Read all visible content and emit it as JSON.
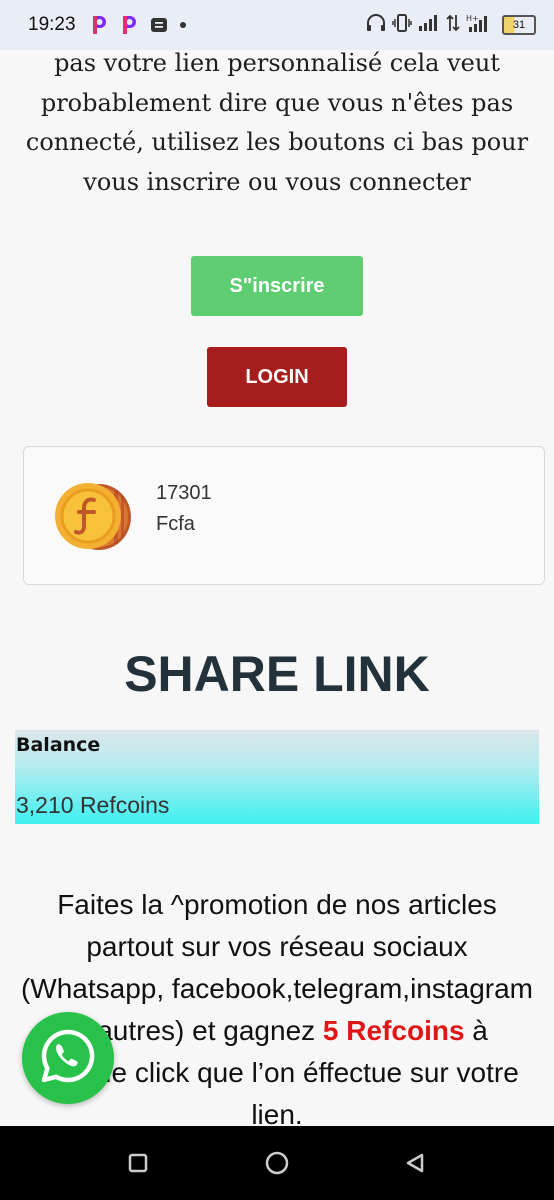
{
  "status_bar": {
    "time": "19:23",
    "battery": "31",
    "network": "H+"
  },
  "intro": {
    "lines": [
      "pas votre lien personnalisé cela veut",
      "probablement dire que vous n'êtes pas",
      "connecté, utilisez les boutons ci bas pour",
      "vous inscrire ou vous connecter"
    ]
  },
  "buttons": {
    "signup": "S\"inscrire",
    "login": "LOGIN"
  },
  "coin_card": {
    "amount": "17301",
    "unit": "Fcfa"
  },
  "share": {
    "title": "SHARE LINK"
  },
  "balance": {
    "label": "Balance",
    "value": "3,210 Refcoins"
  },
  "promo": {
    "text_before": "Faites la ^promotion de nos articles partout sur vos réseau sociaux (Whatsapp, facebook,telegram,instagram et autres) et gagnez ",
    "highlight": "5 Refcoins",
    "text_after": " à chaque click que l’on éffectue sur votre lien."
  },
  "colors": {
    "signup_bg": "#5fcd72",
    "login_bg": "#a71d1d",
    "whatsapp": "#28c24a",
    "highlight": "#e01616"
  },
  "icons": {
    "whatsapp": "whatsapp-icon",
    "coin": "coin-icon"
  }
}
